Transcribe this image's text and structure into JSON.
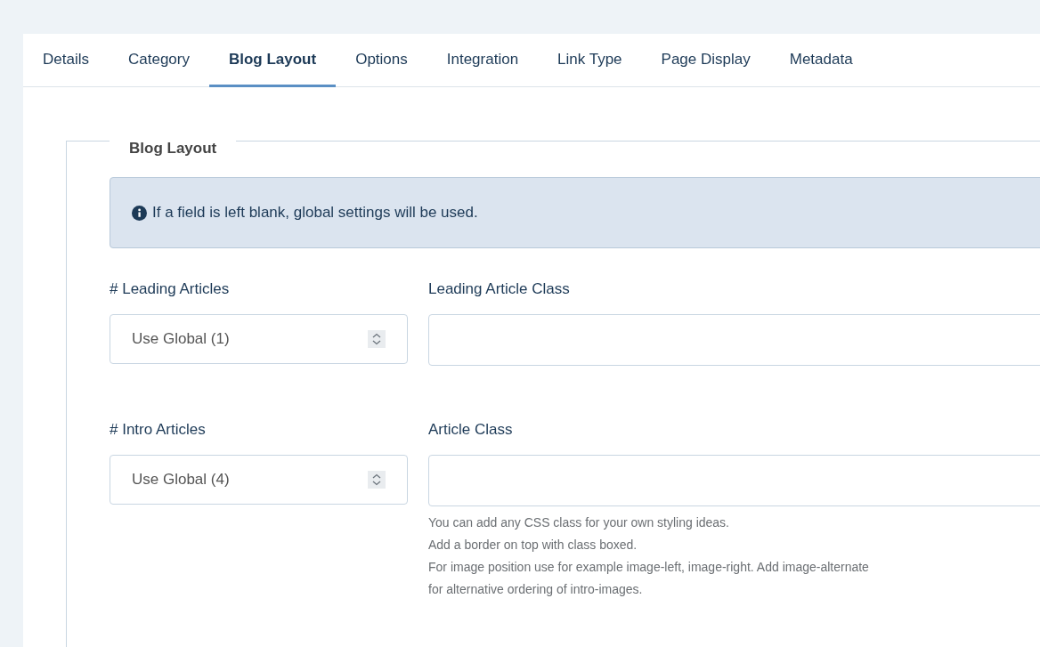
{
  "tabs": [
    {
      "label": "Details",
      "selected": false
    },
    {
      "label": "Category",
      "selected": false
    },
    {
      "label": "Blog Layout",
      "selected": true
    },
    {
      "label": "Options",
      "selected": false
    },
    {
      "label": "Integration",
      "selected": false
    },
    {
      "label": "Link Type",
      "selected": false
    },
    {
      "label": "Page Display",
      "selected": false
    },
    {
      "label": "Metadata",
      "selected": false
    }
  ],
  "fieldset": {
    "legend": "Blog Layout",
    "alert": "If a field is left blank, global settings will be used.",
    "rows": [
      {
        "select_label": "# Leading Articles",
        "select_value": "Use Global (1)",
        "input_label": "Leading Article Class",
        "help": []
      },
      {
        "select_label": "# Intro Articles",
        "select_value": "Use Global (4)",
        "input_label": "Article Class",
        "help": [
          "You can add any CSS class for your own styling ideas.",
          "Add a border on top with class boxed.",
          "For image position use for example image-left, image-right. Add image-alternate",
          "for alternative ordering of intro-images."
        ]
      }
    ]
  }
}
